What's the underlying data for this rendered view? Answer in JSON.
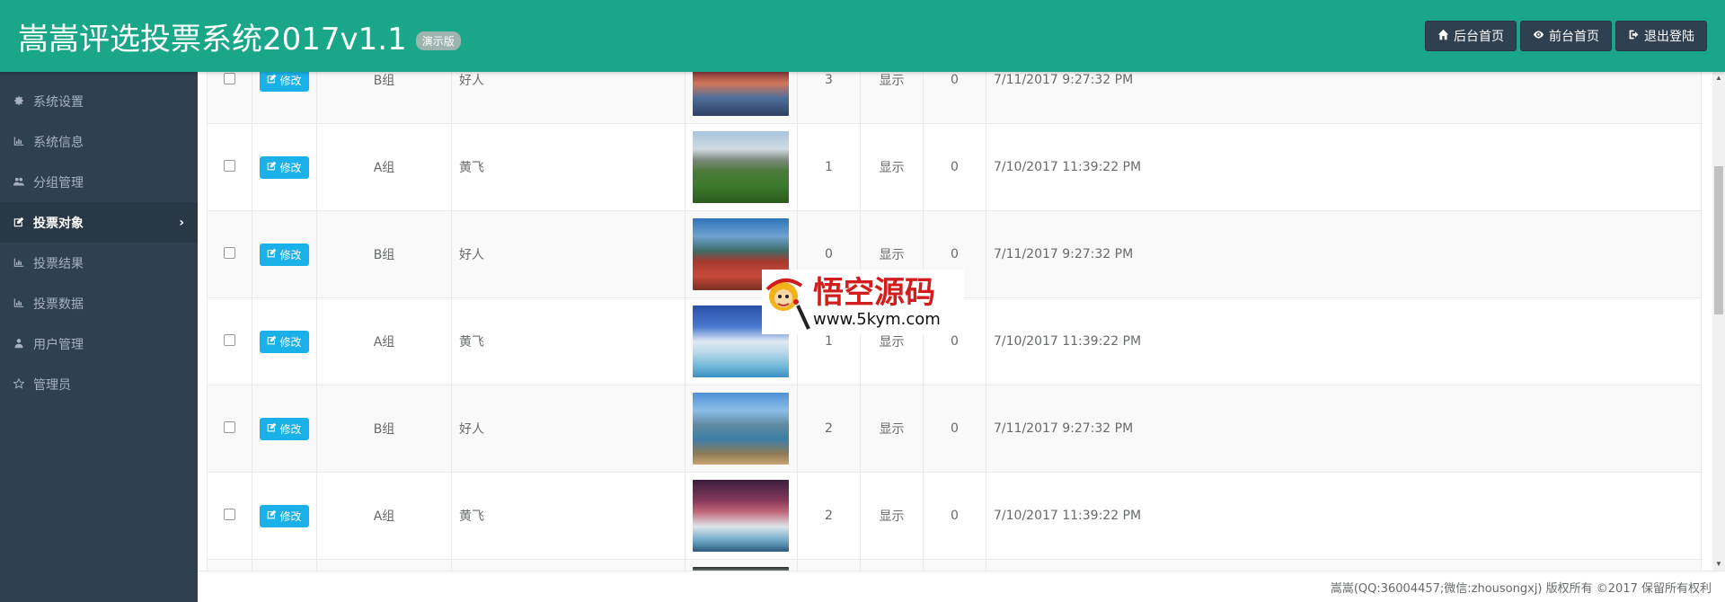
{
  "header": {
    "title": "嵩嵩评选投票系统2017v1.1",
    "badge": "演示版",
    "buttons": [
      {
        "label": "后台首页",
        "icon": "home-icon"
      },
      {
        "label": "前台首页",
        "icon": "eye-icon"
      },
      {
        "label": "退出登陆",
        "icon": "sign-out-icon"
      }
    ]
  },
  "sidebar": {
    "items": [
      {
        "label": "系统设置",
        "icon": "gear-icon",
        "active": false
      },
      {
        "label": "系统信息",
        "icon": "bar-chart-icon",
        "active": false
      },
      {
        "label": "分组管理",
        "icon": "users-icon",
        "active": false
      },
      {
        "label": "投票对象",
        "icon": "edit-icon",
        "active": true
      },
      {
        "label": "投票结果",
        "icon": "bar-chart-icon",
        "active": false
      },
      {
        "label": "投票数据",
        "icon": "bar-chart-icon",
        "active": false
      },
      {
        "label": "用户管理",
        "icon": "user-icon",
        "active": false
      },
      {
        "label": "管理员",
        "icon": "star-icon",
        "active": false
      }
    ],
    "active_chevron": "›"
  },
  "table": {
    "edit_label": "修改",
    "rows": [
      {
        "group": "B组",
        "name": "好人",
        "count": "3",
        "visibility": "显示",
        "num": "0",
        "date": "7/11/2017 9:27:32 PM"
      },
      {
        "group": "A组",
        "name": "黄飞",
        "count": "1",
        "visibility": "显示",
        "num": "0",
        "date": "7/10/2017 11:39:22 PM"
      },
      {
        "group": "B组",
        "name": "好人",
        "count": "0",
        "visibility": "显示",
        "num": "0",
        "date": "7/11/2017 9:27:32 PM"
      },
      {
        "group": "A组",
        "name": "黄飞",
        "count": "1",
        "visibility": "显示",
        "num": "0",
        "date": "7/10/2017 11:39:22 PM"
      },
      {
        "group": "B组",
        "name": "好人",
        "count": "2",
        "visibility": "显示",
        "num": "0",
        "date": "7/11/2017 9:27:32 PM"
      },
      {
        "group": "A组",
        "name": "黄飞",
        "count": "2",
        "visibility": "显示",
        "num": "0",
        "date": "7/10/2017 11:39:22 PM"
      }
    ]
  },
  "watermark": {
    "chinese": "悟空源码",
    "url": "www.5kym.com"
  },
  "footer": {
    "text": "嵩嵩(QQ:36004457;微信:zhousongxj) 版权所有 ©2017 保留所有权利"
  },
  "colors": {
    "header_bg": "#1aa689",
    "sidebar_bg": "#2f4050",
    "edit_button": "#1ab0e8",
    "watermark_red": "#d21d1d"
  }
}
